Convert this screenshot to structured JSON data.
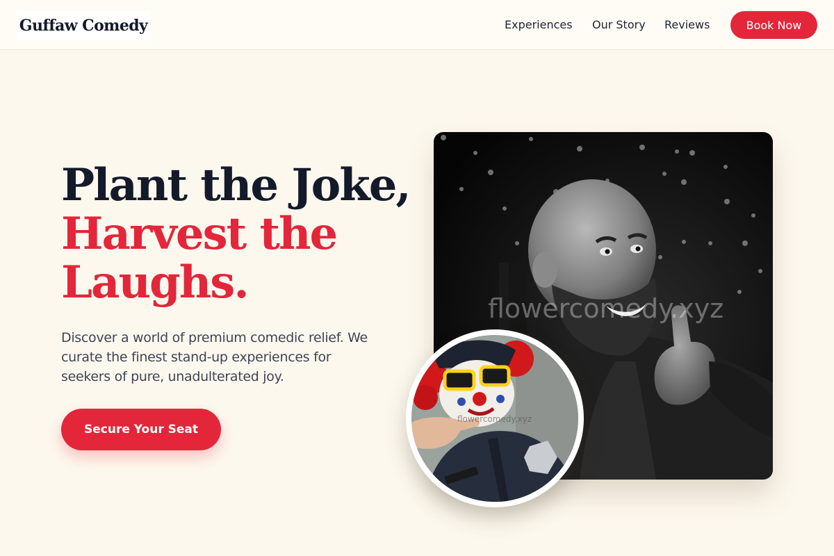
{
  "nav": {
    "logo": "Guffaw Comedy",
    "links": [
      "Experiences",
      "Our Story",
      "Reviews"
    ],
    "cta": "Book Now"
  },
  "hero": {
    "title_line1": "Plant the Joke,",
    "title_line2": "Harvest the",
    "title_line3": "Laughs.",
    "subtitle": "Discover a world of premium comedic relief. We curate the finest stand-up experiences for seekers of pure, unadulterated joy.",
    "cta": "Secure Your Seat"
  },
  "images": {
    "main_watermark": "flowercomedy.xyz",
    "inset_watermark": "flowercomedy.xyz"
  },
  "colors": {
    "accent": "#e3263a",
    "background": "#fdf8ee",
    "text_dark": "#141a2a"
  }
}
